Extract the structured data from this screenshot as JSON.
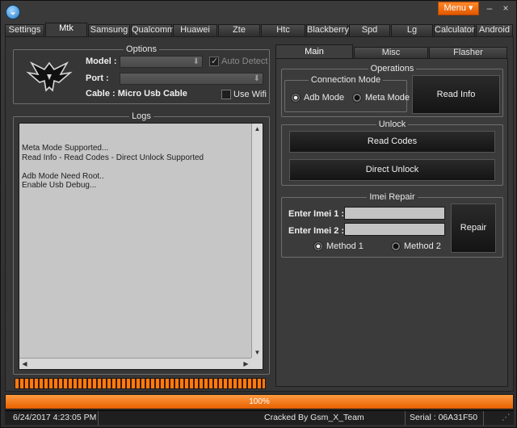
{
  "app": {
    "menu_label": "Menu ▾"
  },
  "tabs": [
    "Settings",
    "Mtk",
    "Samsung",
    "Qualcomm",
    "Huawei",
    "Zte",
    "Htc",
    "Blackberry",
    "Spd",
    "Lg",
    "Calculator",
    "Android"
  ],
  "active_tab": "Mtk",
  "options": {
    "title": "Options",
    "model_label": "Model :",
    "port_label": "Port :",
    "auto_detect_label": "Auto Detect",
    "cable_label": "Cable : Micro Usb Cable",
    "use_wifi_label": "Use Wifi"
  },
  "logs": {
    "title": "Logs",
    "text": "Meta Mode Supported...\nRead Info - Read Codes - Direct Unlock Supported\n\nAdb Mode Need Root..\nEnable Usb Debug..."
  },
  "right_tabs": [
    "Main",
    "Misc",
    "Flasher"
  ],
  "operations": {
    "title": "Operations",
    "connection_mode_title": "Connection Mode",
    "adb_mode_label": "Adb Mode",
    "meta_mode_label": "Meta Mode",
    "selected_mode": "Adb Mode",
    "read_info_label": "Read Info"
  },
  "unlock": {
    "title": "Unlock",
    "read_codes_label": "Read Codes",
    "direct_unlock_label": "Direct Unlock"
  },
  "imei_repair": {
    "title": "Imei Repair",
    "imei1_label": "Enter Imei 1 :",
    "imei2_label": "Enter Imei 2 :",
    "method1_label": "Method 1",
    "method2_label": "Method 2",
    "repair_label": "Repair"
  },
  "progress": {
    "value": 1.0,
    "text": "100%"
  },
  "status": {
    "datetime": "6/24/2017 4:23:05 PM",
    "credit": "Cracked By Gsm_X_Team",
    "serial": "Serial : 06A31F50"
  },
  "colors": {
    "accent": "#ff7a10",
    "background": "#363636"
  }
}
